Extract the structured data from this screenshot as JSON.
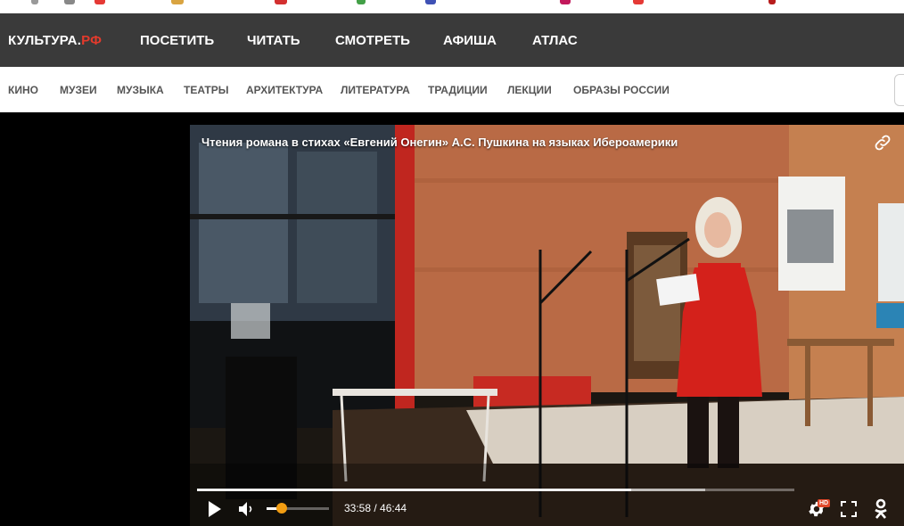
{
  "logo": {
    "text": "КУЛЬТУРА.",
    "accent": "РФ",
    "accent_color": "#e33a2c"
  },
  "main_nav": [
    "ПОСЕТИТЬ",
    "ЧИТАТЬ",
    "СМОТРЕТЬ",
    "АФИША",
    "АТЛАС"
  ],
  "sub_nav": [
    "КИНО",
    "МУЗЕИ",
    "МУЗЫКА",
    "ТЕАТРЫ",
    "АРХИТЕКТУРА",
    "ЛИТЕРАТУРА",
    "ТРАДИЦИИ",
    "ЛЕКЦИИ",
    "ОБРАЗЫ РОССИИ"
  ],
  "player": {
    "title": "Чтения романа в стихах «Евгений Онегин» А.С. Пушкина на языках Ибероамерики",
    "time": "33:58 / 46:44",
    "progress_fraction": 0.727,
    "buffered_fraction": 0.85,
    "volume_fraction": 0.25,
    "quality_badge": "HD",
    "icons": [
      "link-icon",
      "play-icon",
      "volume-icon",
      "settings-icon",
      "fullscreen-icon",
      "odnoklassniki-icon"
    ]
  }
}
